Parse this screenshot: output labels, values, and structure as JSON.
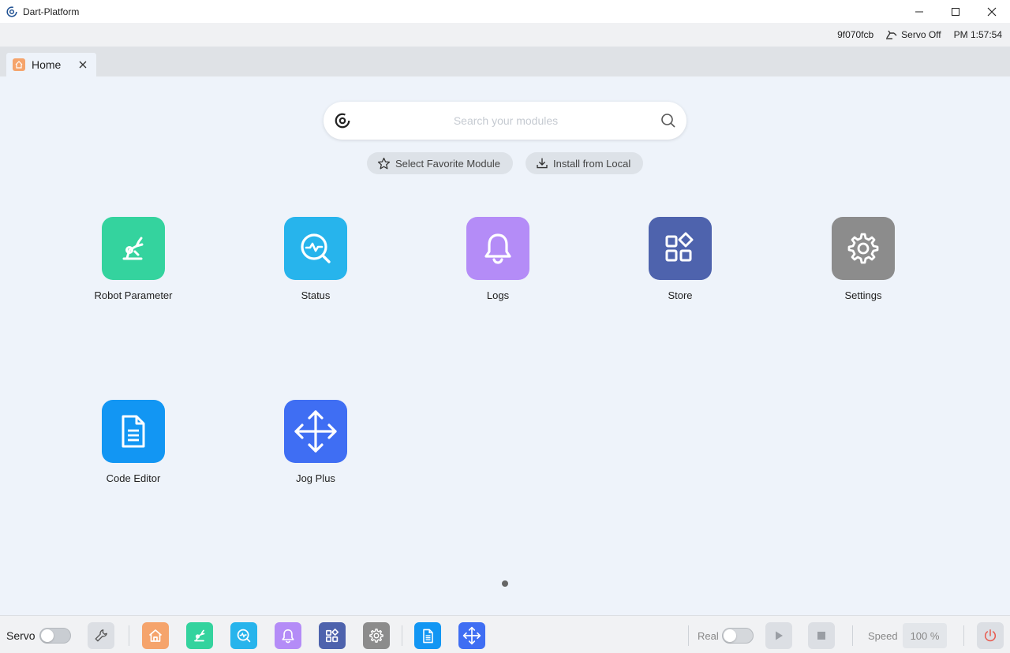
{
  "window": {
    "title": "Dart-Platform",
    "minimize_symbol": "—",
    "maximize_symbol": "☐",
    "close_symbol": "✕"
  },
  "status": {
    "device_id": "9f070fcb",
    "servo_state": "Servo Off",
    "time": "PM 1:57:54"
  },
  "tab": {
    "label": "Home",
    "close_symbol": "✕"
  },
  "search": {
    "placeholder": "Search your modules"
  },
  "actions": {
    "favorite": "Select Favorite Module",
    "install": "Install from Local"
  },
  "modules": [
    {
      "label": "Robot Parameter",
      "color": "#34d39e",
      "icon": "robot-arm-icon"
    },
    {
      "label": "Status",
      "color": "#27b4ec",
      "icon": "status-monitor-icon"
    },
    {
      "label": "Logs",
      "color": "#b48cf7",
      "icon": "bell-icon"
    },
    {
      "label": "Store",
      "color": "#4e63ad",
      "icon": "grid-apps-icon"
    },
    {
      "label": "Settings",
      "color": "#8c8c8c",
      "icon": "gear-icon"
    },
    {
      "label": "Code Editor",
      "color": "#1296f3",
      "icon": "document-icon"
    },
    {
      "label": "Jog Plus",
      "color": "#3f6ef3",
      "icon": "move-arrows-icon"
    }
  ],
  "toolbar": {
    "servo_label": "Servo",
    "real_label": "Real",
    "speed_label": "Speed",
    "speed_value": "100 %",
    "servo_enabled": false,
    "real_enabled": false
  },
  "colors": {
    "background": "#eef3fa",
    "home": "#f5a46c",
    "power": "#e85a4f"
  }
}
